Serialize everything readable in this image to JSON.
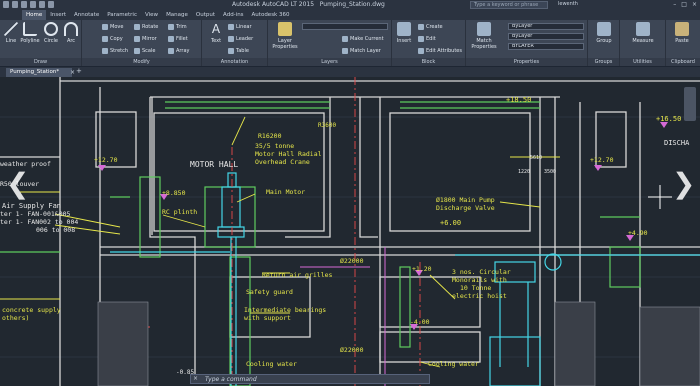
{
  "app": {
    "title": "Autodesk AutoCAD LT 2015",
    "filename": "Pumping_Station.dwg",
    "search_placeholder": "Type a keyword or phrase",
    "user": "lewenth"
  },
  "ribbon_tabs": [
    "Home",
    "Insert",
    "Annotate",
    "Parametric",
    "View",
    "Manage",
    "Output",
    "Add-ins",
    "Autodesk 360"
  ],
  "ribbon": {
    "draw": {
      "label": "Draw",
      "tools": [
        "Line",
        "Polyline",
        "Circle",
        "Arc"
      ]
    },
    "modify": {
      "label": "Modify",
      "tools": [
        "Move",
        "Rotate",
        "Trim",
        "Copy",
        "Mirror",
        "Fillet",
        "Stretch",
        "Scale",
        "Array"
      ]
    },
    "annotation": {
      "label": "Annotation",
      "tools": [
        "Text",
        "Linear",
        "Leader",
        "Table"
      ]
    },
    "layers": {
      "label": "Layers",
      "tools": [
        "Layer Properties",
        "Make Current",
        "Match Layer"
      ]
    },
    "block": {
      "label": "Block",
      "tools": [
        "Insert",
        "Create",
        "Edit",
        "Edit Attributes"
      ]
    },
    "properties": {
      "label": "Properties",
      "tools": [
        "Match Properties"
      ],
      "dropdowns": [
        "ByLayer",
        "ByLayer",
        "BYLAYER"
      ]
    },
    "groups": {
      "label": "Groups",
      "tools": [
        "Group"
      ]
    },
    "utilities": {
      "label": "Utilities",
      "tools": [
        "Measure"
      ]
    },
    "clipboard": {
      "label": "Clipboard",
      "tools": [
        "Paste"
      ]
    }
  },
  "document_tab": {
    "label": "Pumping_Station*"
  },
  "command_line": {
    "prompt": "Type a command"
  },
  "drawing": {
    "annotations": {
      "weather_proof": "weather proof",
      "louver": "R50 louver",
      "air_supply": "Air Supply Fan",
      "fan_line1": "ter 1- FAN-001&005",
      "fan_line2": "ter 1- FAN002 to 004",
      "fan_line3": "006 to 008",
      "motor_hall": "MOTOR HALL",
      "crane_1": "35/5 tonne",
      "crane_2": "Motor Hall Radial",
      "crane_3": "Overhead Crane",
      "r16200": "R16200",
      "r3600": "R3600",
      "lvl_1850": "+18.50",
      "lvl_1650": "+16.50",
      "lvl_1270": "+12.70",
      "lvl_1270b": "+12.70",
      "lvl_850": "+8.850",
      "lvl_600": "+6.00",
      "lvl_490": "+4.90",
      "lvl_120": "+1.20",
      "lvl_400": "-4.00",
      "main_motor": "Main Motor",
      "rc_plinth": "RC plinth",
      "pump_valve_1": "Ø1800 Main Pump",
      "pump_valve_2": "Discharge Valve",
      "discharge": "DISCHA",
      "dia_22000": "Ø22000",
      "dia_22000b": "Ø22000",
      "return_grilles": "Return air grilles",
      "safety_guard": "Safety guard",
      "bearings_1": "Intermediate bearings",
      "bearings_2": "with support",
      "monorails_1": "3 nos. Circular",
      "monorails_2": "Monorails with",
      "monorails_3": "10 Tonne",
      "monorails_4": "electric hoist",
      "concrete_1": "concrete supply",
      "concrete_2": "others)",
      "cooling_1": "Cooling water",
      "cooling_2": "Cooling water",
      "dim_5610": "5610",
      "dim_1220": "1220",
      "dim_3500": "3500",
      "lvl_085": "-0.85"
    }
  }
}
